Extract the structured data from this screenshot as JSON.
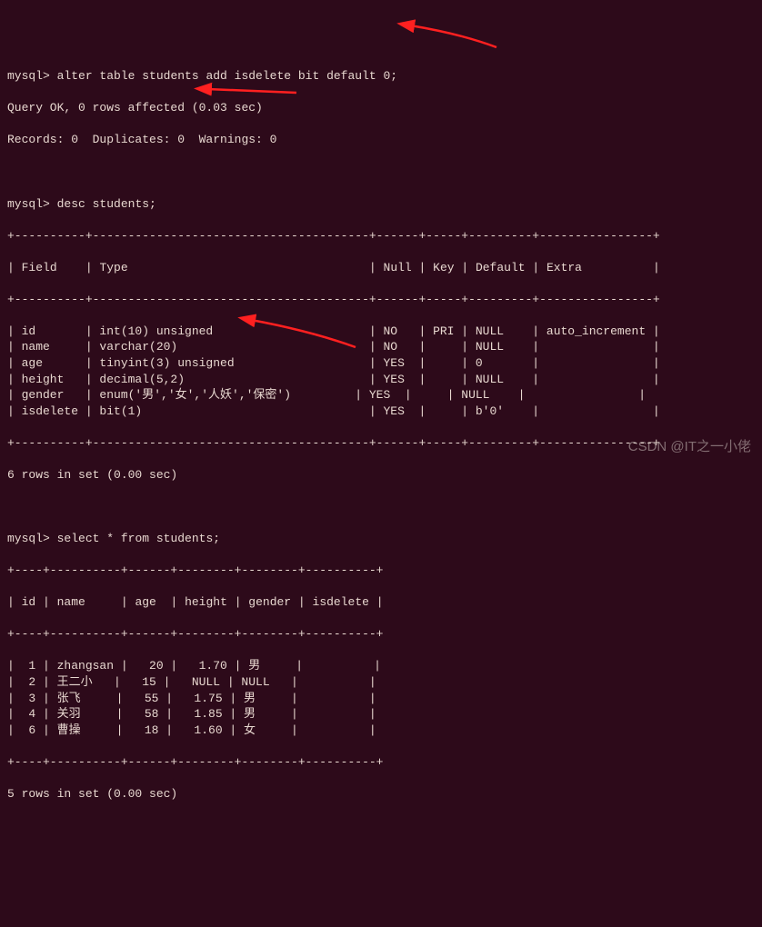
{
  "prompt": "mysql>",
  "cmd1": "alter table students add isdelete bit default 0;",
  "cmd1_result1": "Query OK, 0 rows affected (0.03 sec)",
  "cmd1_result2": "Records: 0  Duplicates: 0  Warnings: 0",
  "cmd2": "desc students;",
  "desc_border": "+----------+---------------------------------------+------+-----+---------+----------------+",
  "desc_header": {
    "field": "Field",
    "type": "Type",
    "null": "Null",
    "key": "Key",
    "default": "Default",
    "extra": "Extra"
  },
  "desc_rows": [
    {
      "field": "id",
      "type": "int(10) unsigned",
      "null": "NO",
      "key": "PRI",
      "default": "NULL",
      "extra": "auto_increment"
    },
    {
      "field": "name",
      "type": "varchar(20)",
      "null": "NO",
      "key": "",
      "default": "NULL",
      "extra": ""
    },
    {
      "field": "age",
      "type": "tinyint(3) unsigned",
      "null": "YES",
      "key": "",
      "default": "0",
      "extra": ""
    },
    {
      "field": "height",
      "type": "decimal(5,2)",
      "null": "YES",
      "key": "",
      "default": "NULL",
      "extra": ""
    },
    {
      "field": "gender",
      "type": "enum('男','女','人妖','保密')",
      "null": "YES",
      "key": "",
      "default": "NULL",
      "extra": ""
    },
    {
      "field": "isdelete",
      "type": "bit(1)",
      "null": "YES",
      "key": "",
      "default": "b'0'",
      "extra": ""
    }
  ],
  "desc_footer": "6 rows in set (0.00 sec)",
  "cmd3": "select * from students;",
  "sel_border": "+----+----------+------+--------+--------+----------+",
  "sel_header": {
    "id": "id",
    "name": "name",
    "age": "age",
    "height": "height",
    "gender": "gender",
    "isdelete": "isdelete"
  },
  "sel_rows": [
    {
      "id": "1",
      "name": "zhangsan",
      "age": "20",
      "height": "1.70",
      "gender": "男",
      "isdelete": ""
    },
    {
      "id": "2",
      "name": "王二小",
      "age": "15",
      "height": "NULL",
      "gender": "NULL",
      "isdelete": ""
    },
    {
      "id": "3",
      "name": "张飞",
      "age": "55",
      "height": "1.75",
      "gender": "男",
      "isdelete": ""
    },
    {
      "id": "4",
      "name": "关羽",
      "age": "58",
      "height": "1.85",
      "gender": "男",
      "isdelete": ""
    },
    {
      "id": "6",
      "name": "曹操",
      "age": "18",
      "height": "1.60",
      "gender": "女",
      "isdelete": ""
    }
  ],
  "sel_footer": "5 rows in set (0.00 sec)",
  "watermark": "CSDN @IT之一小佬"
}
